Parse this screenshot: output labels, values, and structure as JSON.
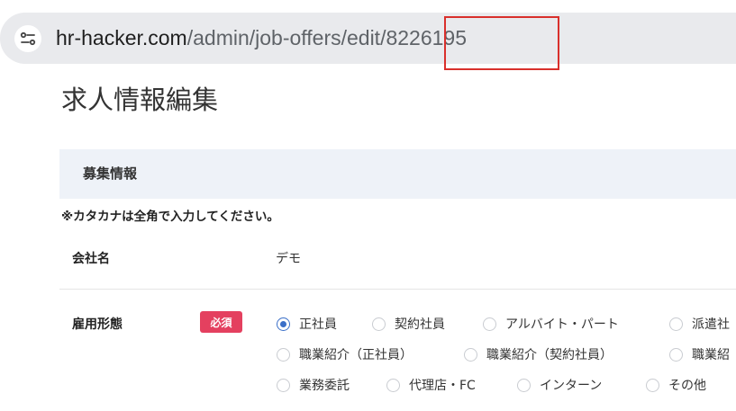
{
  "browser": {
    "url_host": "hr-hacker.com",
    "url_path": "/admin/job-offers/edit/8226195",
    "site_info_icon": "tune-icon"
  },
  "page": {
    "title": "求人情報編集"
  },
  "section": {
    "header": "募集情報",
    "note": "※カタカナは全角で入力してください。"
  },
  "fields": {
    "company": {
      "label": "会社名",
      "value": "デモ"
    },
    "employment": {
      "label": "雇用形態",
      "badge": "必須",
      "options": [
        {
          "label": "正社員",
          "checked": true
        },
        {
          "label": "契約社員",
          "checked": false
        },
        {
          "label": "アルバイト・パート",
          "checked": false
        },
        {
          "label": "派遣社",
          "checked": false
        },
        {
          "label": "職業紹介（正社員）",
          "checked": false
        },
        {
          "label": "職業紹介（契約社員）",
          "checked": false
        },
        {
          "label": "職業紹",
          "checked": false
        },
        {
          "label": "業務委託",
          "checked": false
        },
        {
          "label": "代理店・FC",
          "checked": false
        },
        {
          "label": "インターン",
          "checked": false
        },
        {
          "label": "その他",
          "checked": false
        }
      ]
    }
  },
  "colors": {
    "accent": "#3a6fc8",
    "required": "#e4405f",
    "highlight": "#d9302c",
    "section_bg": "#eef2f8"
  }
}
